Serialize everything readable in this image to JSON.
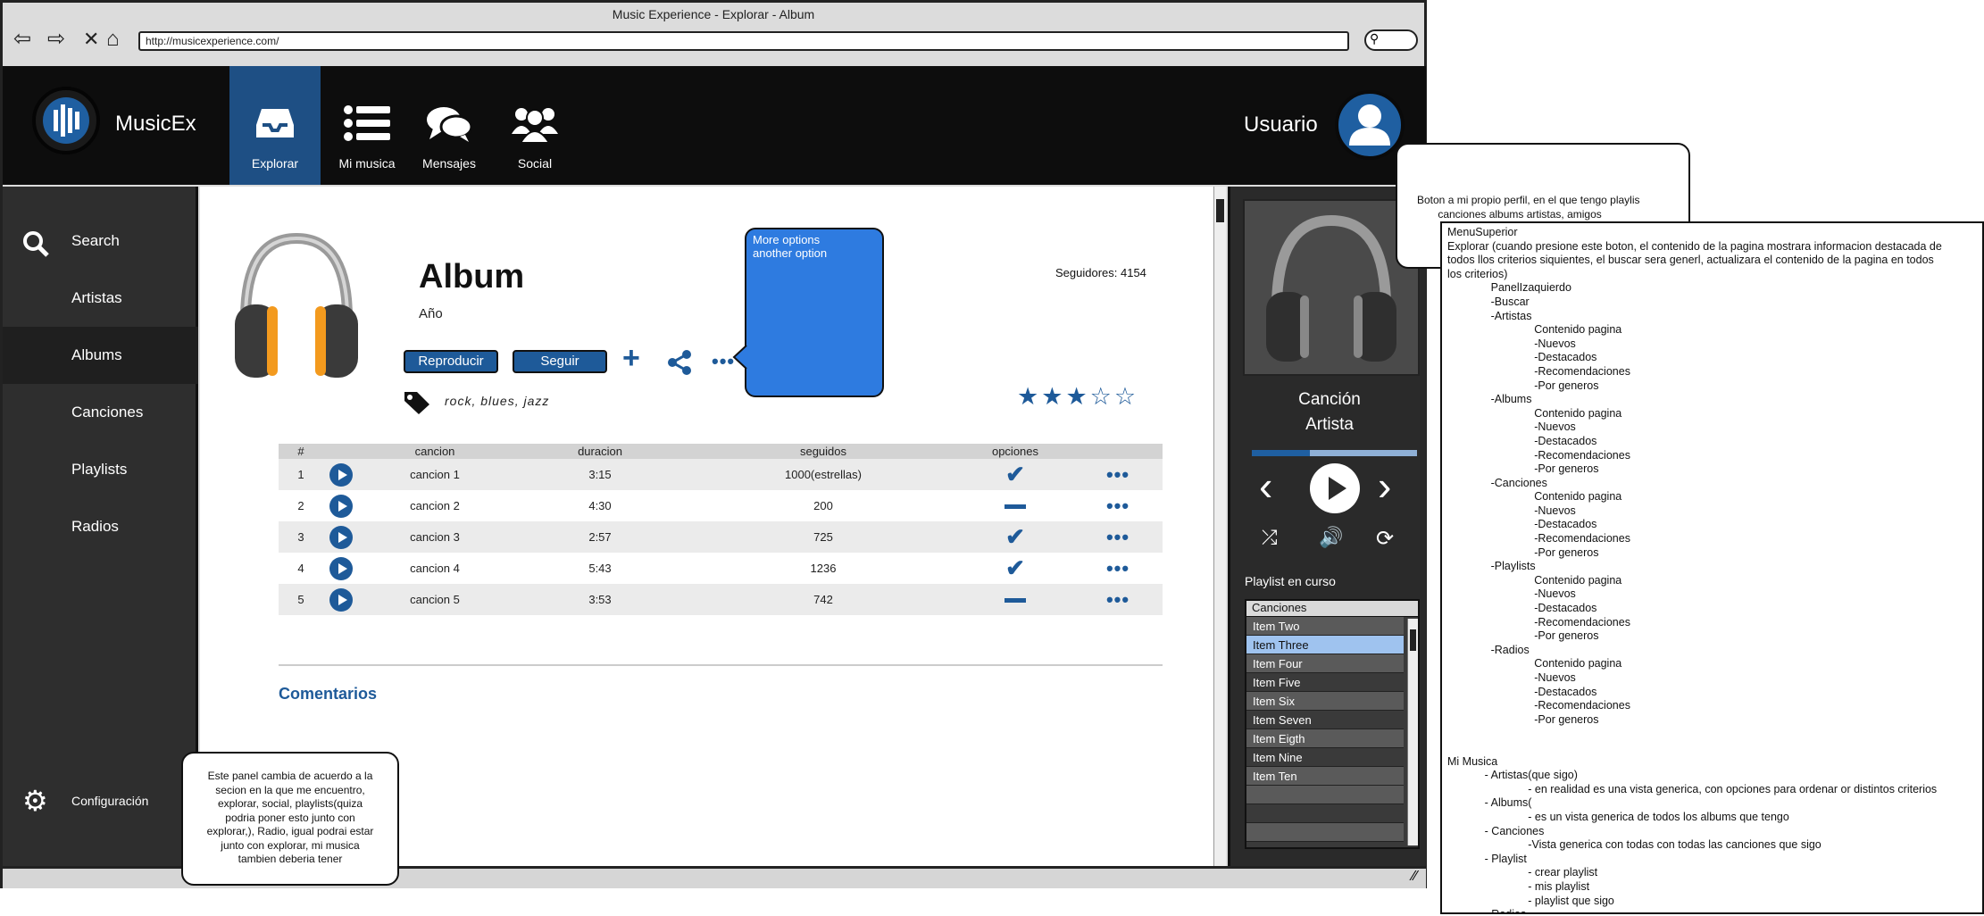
{
  "window": {
    "title": "Music Experience - Explorar - Album",
    "url": "http://musicexperience.com/"
  },
  "header": {
    "brand": "MusicEx",
    "nav": [
      {
        "label": "Explorar",
        "active": true
      },
      {
        "label": "Mi musica"
      },
      {
        "label": "Mensajes"
      },
      {
        "label": "Social"
      }
    ],
    "user_label": "Usuario"
  },
  "sidebar": {
    "items": [
      {
        "label": "Search",
        "icon": "search-icon"
      },
      {
        "label": "Artistas"
      },
      {
        "label": "Albums",
        "active": true
      },
      {
        "label": "Canciones"
      },
      {
        "label": "Playlists"
      },
      {
        "label": "Radios"
      }
    ],
    "settings_label": "Configuración"
  },
  "album": {
    "title": "Album",
    "year": "Año",
    "followers": "Seguidores: 4154",
    "play_label": "Reproducir",
    "follow_label": "Seguir",
    "rating": 3,
    "rating_max": 5,
    "tags_text": "rock, blues, jazz"
  },
  "options_popup": {
    "line1": "More options",
    "line2": "another option"
  },
  "table": {
    "headers": [
      "#",
      "cancion",
      "duracion",
      "seguidos",
      "opciones"
    ],
    "rows": [
      {
        "n": "1",
        "name": "cancion 1",
        "duration": "3:15",
        "followers": "1000(estrellas)",
        "followed": true
      },
      {
        "n": "2",
        "name": "cancion 2",
        "duration": "4:30",
        "followers": "200",
        "followed": false
      },
      {
        "n": "3",
        "name": "cancion 3",
        "duration": "2:57",
        "followers": "725",
        "followed": true
      },
      {
        "n": "4",
        "name": "cancion 4",
        "duration": "5:43",
        "followers": "1236",
        "followed": true
      },
      {
        "n": "5",
        "name": "cancion 5",
        "duration": "3:53",
        "followers": "742",
        "followed": false
      }
    ]
  },
  "comments_heading": "Comentarios",
  "player": {
    "song": "Canción",
    "artist": "Artista",
    "progress": 0.35,
    "playlist_heading": "Playlist en curso",
    "playlist_header": "Canciones",
    "items": [
      "Item Two",
      "Item Three",
      "Item Four",
      "Item Five",
      "Item Six",
      "Item Seven",
      "Item Eigth",
      "Item Nine",
      "Item Ten"
    ],
    "selected_item": "Item Three"
  },
  "notes": {
    "profile_note": "Boton a mi propio perfil, en el que tengo playlis\n       canciones albums artistas, amigos",
    "sidebar_note": "Este panel cambia de acuerdo a la\nsecion en la que me encuentro,\nexplorar, social, playlists(quiza\npodria poner esto junto con\nexplorar,), Radio, igual podrai estar\njunto con explorar, mi musica\ntambien deberia tener",
    "spec_text": "MenuSuperior\nExplorar (cuando presione este boton, el contenido de la pagina mostrara informacion destacada de\ntodos llos criterios siquientes, el buscar sera generl, actualizara el contenido de la pagina en todos\nlos criterios)\n              PanelIzaquierdo\n              -Buscar\n              -Artistas\n                            Contenido pagina\n                            -Nuevos\n                            -Destacados\n                            -Recomendaciones\n                            -Por generos\n              -Albums\n                            Contenido pagina\n                            -Nuevos\n                            -Destacados\n                            -Recomendaciones\n                            -Por generos\n              -Canciones\n                            Contenido pagina\n                            -Nuevos\n                            -Destacados\n                            -Recomendaciones\n                            -Por generos\n              -Playlists\n                            Contenido pagina\n                            -Nuevos\n                            -Destacados\n                            -Recomendaciones\n                            -Por generos\n              -Radios\n                            Contenido pagina\n                            -Nuevos\n                            -Destacados\n                            -Recomendaciones\n                            -Por generos\n\n\nMi Musica\n            - Artistas(que sigo)\n                          - en realidad es una vista generica, con opciones para ordenar or distintos criterios\n            - Albums(\n                          - es un vista generica de todos los albums que tengo\n            - Canciones\n                          -Vista generica con todas con todas las canciones que sigo\n            - Playlist\n                          - crear playlist\n                          - mis playlist\n                          - playlist que sigo\n            - Radios"
  },
  "colors": {
    "accent": "#1e5a99",
    "nav_active": "#1e4f84",
    "popup": "#2e7be0",
    "playlist_selected": "#9fc3ef"
  }
}
